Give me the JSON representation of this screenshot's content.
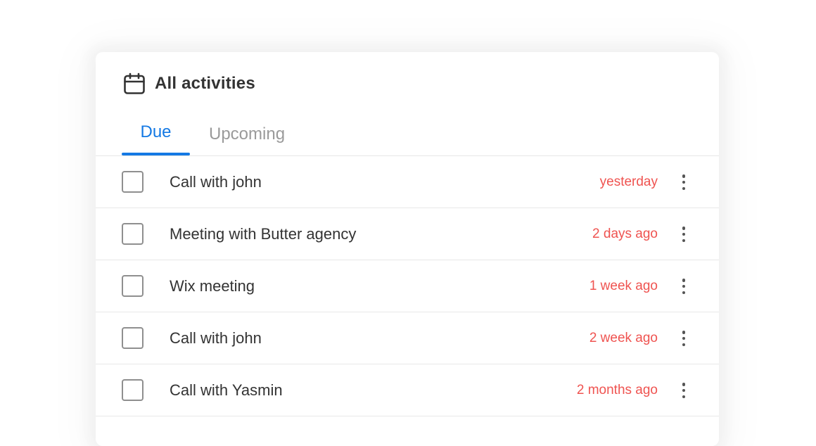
{
  "header": {
    "title": "All activities",
    "icon": "calendar-icon"
  },
  "tabs": [
    {
      "label": "Due",
      "active": true
    },
    {
      "label": "Upcoming",
      "active": false
    }
  ],
  "activities": [
    {
      "label": "Call with john",
      "time": "yesterday",
      "checked": false
    },
    {
      "label": "Meeting with Butter agency",
      "time": "2 days ago",
      "checked": false
    },
    {
      "label": "Wix meeting",
      "time": "1 week ago",
      "checked": false
    },
    {
      "label": "Call with john",
      "time": "2 week ago",
      "checked": false
    },
    {
      "label": "Call with Yasmin",
      "time": "2 months ago",
      "checked": false
    }
  ],
  "colors": {
    "accent": "#1479e4",
    "overdue": "#ef5350",
    "text": "#333333",
    "muted": "#9a9a9a"
  }
}
